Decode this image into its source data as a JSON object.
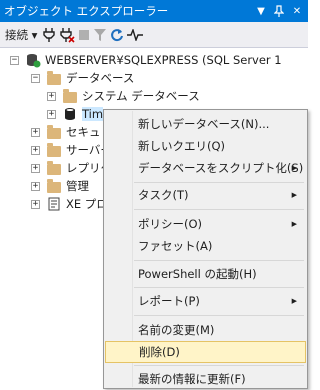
{
  "window": {
    "title": "オブジェクト エクスプローラー"
  },
  "toolbar": {
    "connect_label": "接続 ▾"
  },
  "tree": {
    "server": "WEBSERVER¥SQLEXPRESS (SQL Server 1",
    "databases": "データベース",
    "system_databases": "システム データベース",
    "selected_db": "Tim",
    "security": "セキュリ",
    "server_objects": "サーバー",
    "replication": "レプリケ",
    "management": "管理",
    "xe_profiler": "XE プロフ"
  },
  "context_menu": {
    "items": [
      {
        "label": "新しいデータベース(N)..."
      },
      {
        "label": "新しいクエリ(Q)"
      },
      {
        "label": "データベースをスクリプト化(S)"
      },
      {
        "label": "タスク(T)"
      },
      {
        "label": "ポリシー(O)"
      },
      {
        "label": "ファセット(A)"
      },
      {
        "label": "PowerShell の起動(H)"
      },
      {
        "label": "レポート(P)"
      },
      {
        "label": "名前の変更(M)"
      },
      {
        "label": "削除(D)"
      },
      {
        "label": "最新の情報に更新(F)"
      }
    ]
  }
}
